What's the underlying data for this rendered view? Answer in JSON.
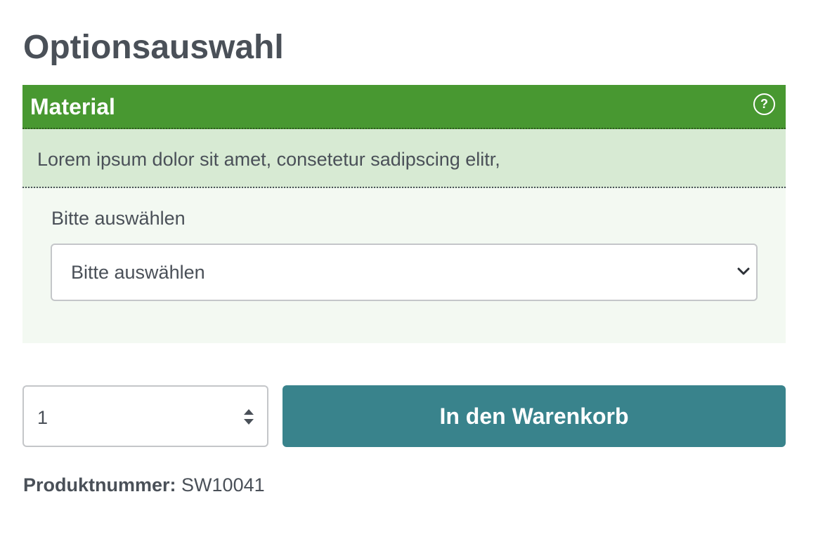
{
  "page": {
    "title": "Optionsauswahl"
  },
  "option_group": {
    "title": "Material",
    "help_icon": "question-circle-icon",
    "description": "Lorem ipsum dolor sit amet, consetetur sadipscing elitr,",
    "select_label": "Bitte auswählen",
    "select_value": "Bitte auswählen",
    "chevron_icon": "chevron-down-icon"
  },
  "purchase": {
    "quantity": "1",
    "stepper_icon": "sort-arrows-icon",
    "cart_button_label": "In den Warenkorb"
  },
  "product": {
    "number_label": "Produktnummer:",
    "number_value": "SW10041"
  },
  "colors": {
    "header_green": "#489831",
    "description_green": "#d7ead3",
    "panel_background": "#f3f9f2",
    "cart_button_teal": "#39838c",
    "text_gray": "#4a5058"
  }
}
